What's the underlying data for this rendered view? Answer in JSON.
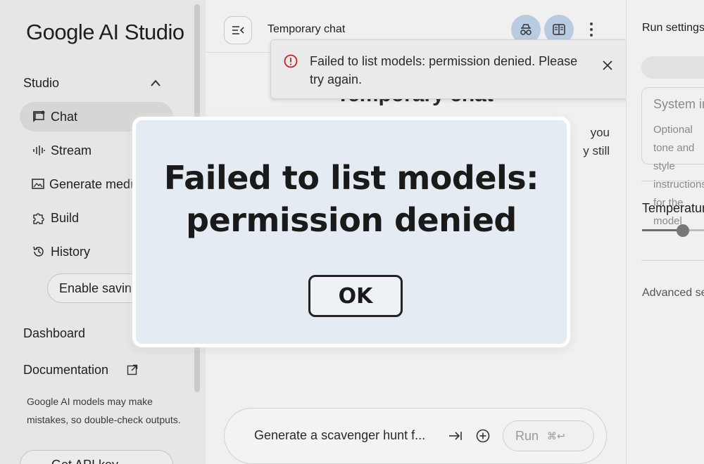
{
  "app": {
    "logo_text": "Google AI Studio"
  },
  "sidebar": {
    "section_title": "Studio",
    "items": [
      {
        "label": "Chat",
        "icon": "chat-icon",
        "active": true
      },
      {
        "label": "Stream",
        "icon": "waveform-icon",
        "active": false
      },
      {
        "label": "Generate media",
        "icon": "image-icon",
        "active": false
      },
      {
        "label": "Build",
        "icon": "puzzle-icon",
        "active": false
      },
      {
        "label": "History",
        "icon": "history-icon",
        "active": false
      }
    ],
    "enable_saving_label": "Enable saving",
    "dashboard_label": "Dashboard",
    "documentation_label": "Documentation",
    "disclaimer": "Google AI models may make mistakes, so double-check outputs.",
    "get_api_key_label": "Get API key"
  },
  "header": {
    "title": "Temporary chat"
  },
  "toast": {
    "message": "Failed to list models: permission denied. Please try again.",
    "icon": "error-icon",
    "color": "#c5221f"
  },
  "main": {
    "heading": "Temporary chat",
    "intro_line1": "you",
    "intro_line2": "y still"
  },
  "prompt": {
    "text": "Generate a scavenger hunt f...",
    "run_label": "Run",
    "run_shortcut": "⌘↩"
  },
  "right_panel": {
    "title": "Run settings",
    "system_title": "System instructions",
    "system_hint": "Optional tone and style instructions for the model",
    "temperature_label": "Temperature",
    "temperature_level": 0.65,
    "advanced_label": "Advanced settings"
  },
  "dialog": {
    "line1": "Failed to list models:",
    "line2": "permission denied",
    "ok_label": "OK"
  },
  "colors": {
    "accent_circle": "#b9cbe0",
    "dialog_bg": "#e4ebf3"
  }
}
